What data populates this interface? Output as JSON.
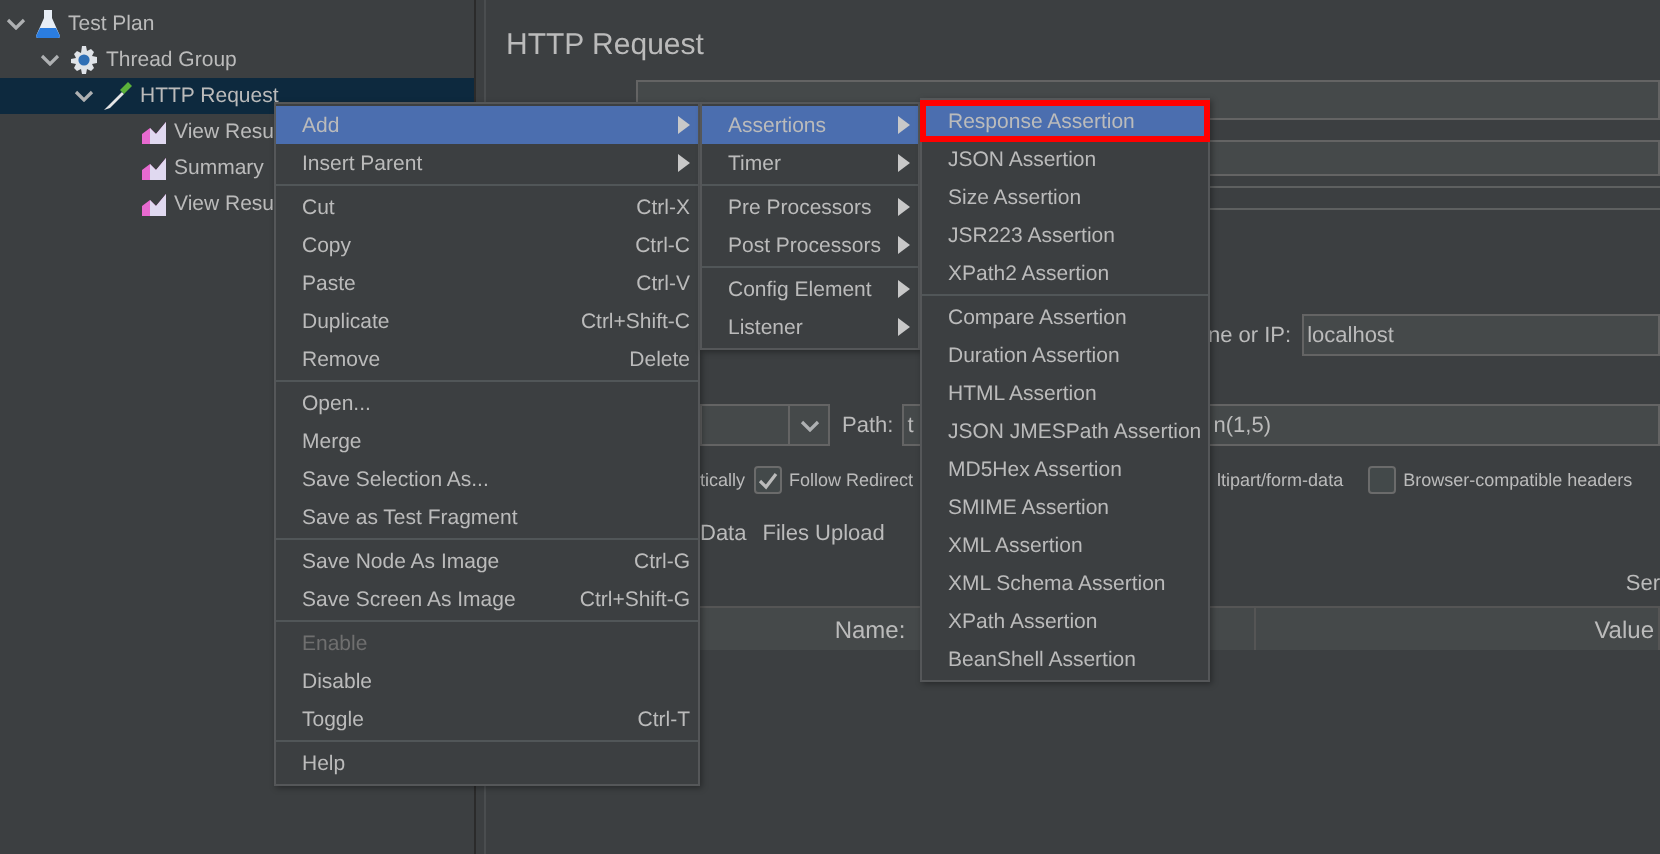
{
  "tree": [
    {
      "label": "Test Plan",
      "kind": "flask",
      "expanded": true,
      "selected": false,
      "children": [
        {
          "label": "Thread Group",
          "kind": "gear",
          "expanded": true,
          "selected": false,
          "children": [
            {
              "label": "HTTP Request",
              "kind": "pipette",
              "expanded": true,
              "selected": true,
              "children": [
                {
                  "label": "View Resu",
                  "kind": "chart",
                  "selected": false
                },
                {
                  "label": "Summary",
                  "kind": "chart",
                  "selected": false
                },
                {
                  "label": "View Resu",
                  "kind": "chart",
                  "selected": false
                }
              ]
            }
          ]
        }
      ]
    }
  ],
  "panel": {
    "title": "HTTP Request",
    "server_label": "ne or IP:",
    "server_value": "localhost",
    "path_label": "Path:",
    "path_value_start": "t",
    "path_value_end": "n(1,5)",
    "options": [
      {
        "kind": "text",
        "label": "tically"
      },
      {
        "kind": "checkbox",
        "label": "Follow Redirect",
        "checked": true
      },
      {
        "kind": "text",
        "label": "ltipart/form-data"
      },
      {
        "kind": "checkbox",
        "label": "Browser-compatible headers",
        "checked": false
      }
    ],
    "tabs": [
      "Data",
      "Files Upload"
    ],
    "section_label": "Ser",
    "columns": [
      "Name:",
      "Value"
    ]
  },
  "context_menu": [
    [
      {
        "label": "Add",
        "submenu": true,
        "selected": true,
        "disabled": false
      },
      {
        "label": "Insert Parent",
        "submenu": true,
        "selected": false,
        "disabled": false
      }
    ],
    [
      {
        "label": "Cut",
        "shortcut": "Ctrl-X",
        "selected": false,
        "disabled": false
      },
      {
        "label": "Copy",
        "shortcut": "Ctrl-C",
        "selected": false,
        "disabled": false
      },
      {
        "label": "Paste",
        "shortcut": "Ctrl-V",
        "selected": false,
        "disabled": false
      },
      {
        "label": "Duplicate",
        "shortcut": "Ctrl+Shift-C",
        "selected": false,
        "disabled": false
      },
      {
        "label": "Remove",
        "shortcut": "Delete",
        "selected": false,
        "disabled": false
      }
    ],
    [
      {
        "label": "Open...",
        "selected": false,
        "disabled": false
      },
      {
        "label": "Merge",
        "selected": false,
        "disabled": false
      },
      {
        "label": "Save Selection As...",
        "selected": false,
        "disabled": false
      },
      {
        "label": "Save as Test Fragment",
        "selected": false,
        "disabled": false
      }
    ],
    [
      {
        "label": "Save Node As Image",
        "shortcut": "Ctrl-G",
        "selected": false,
        "disabled": false
      },
      {
        "label": "Save Screen As Image",
        "shortcut": "Ctrl+Shift-G",
        "selected": false,
        "disabled": false
      }
    ],
    [
      {
        "label": "Enable",
        "selected": false,
        "disabled": true
      },
      {
        "label": "Disable",
        "selected": false,
        "disabled": false
      },
      {
        "label": "Toggle",
        "shortcut": "Ctrl-T",
        "selected": false,
        "disabled": false
      }
    ],
    [
      {
        "label": "Help",
        "selected": false,
        "disabled": false
      }
    ]
  ],
  "add_menu": [
    [
      {
        "label": "Assertions",
        "submenu": true,
        "selected": true
      },
      {
        "label": "Timer",
        "submenu": true,
        "selected": false
      }
    ],
    [
      {
        "label": "Pre Processors",
        "submenu": true,
        "selected": false
      },
      {
        "label": "Post Processors",
        "submenu": true,
        "selected": false
      }
    ],
    [
      {
        "label": "Config Element",
        "submenu": true,
        "selected": false
      },
      {
        "label": "Listener",
        "submenu": true,
        "selected": false
      }
    ]
  ],
  "assertions_menu": [
    [
      {
        "label": "Response Assertion",
        "selected": true,
        "outlined": true
      },
      {
        "label": "JSON Assertion",
        "selected": false,
        "outlined": false
      },
      {
        "label": "Size Assertion",
        "selected": false,
        "outlined": false
      },
      {
        "label": "JSR223 Assertion",
        "selected": false,
        "outlined": false
      },
      {
        "label": "XPath2 Assertion",
        "selected": false,
        "outlined": false
      }
    ],
    [
      {
        "label": "Compare Assertion",
        "selected": false,
        "outlined": false
      },
      {
        "label": "Duration Assertion",
        "selected": false,
        "outlined": false
      },
      {
        "label": "HTML Assertion",
        "selected": false,
        "outlined": false
      },
      {
        "label": "JSON JMESPath Assertion",
        "selected": false,
        "outlined": false
      },
      {
        "label": "MD5Hex Assertion",
        "selected": false,
        "outlined": false
      },
      {
        "label": "SMIME Assertion",
        "selected": false,
        "outlined": false
      },
      {
        "label": "XML Assertion",
        "selected": false,
        "outlined": false
      },
      {
        "label": "XML Schema Assertion",
        "selected": false,
        "outlined": false
      },
      {
        "label": "XPath Assertion",
        "selected": false,
        "outlined": false
      },
      {
        "label": "BeanShell Assertion",
        "selected": false,
        "outlined": false
      }
    ]
  ]
}
